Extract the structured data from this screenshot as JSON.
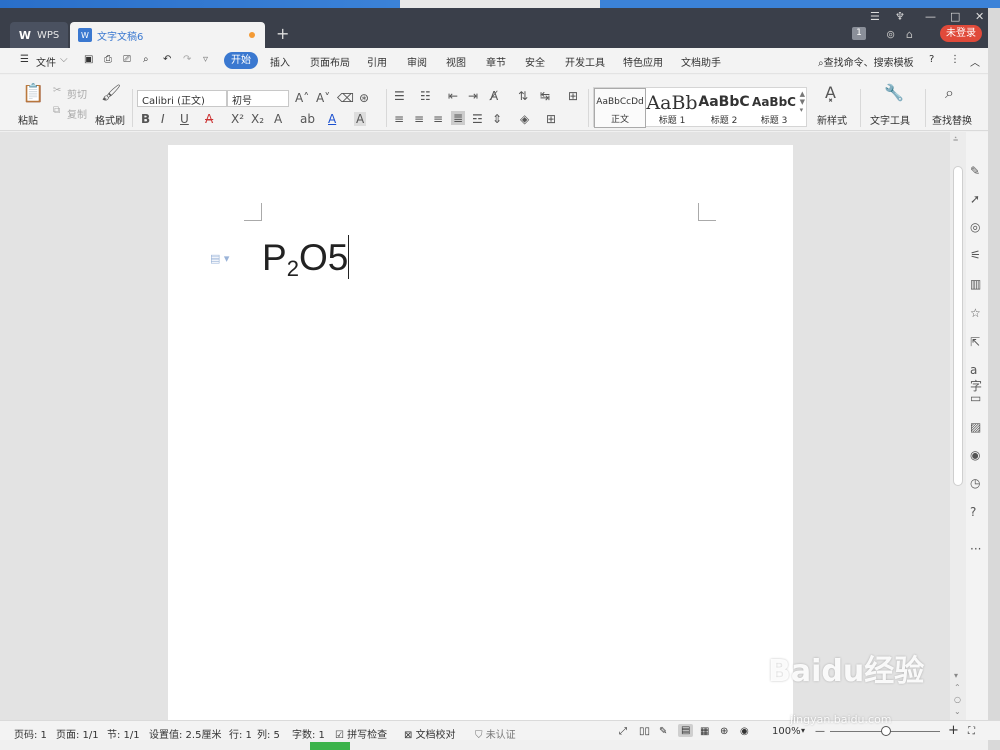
{
  "titlebar": {
    "tabs": [
      {
        "label": "WPS"
      },
      {
        "label": "文字文稿6"
      }
    ],
    "new_tab": "+",
    "badge": "1",
    "login": "未登录"
  },
  "menubar": {
    "file": "文件",
    "items": [
      "开始",
      "插入",
      "页面布局",
      "引用",
      "审阅",
      "视图",
      "章节",
      "安全",
      "开发工具",
      "特色应用",
      "文档助手"
    ],
    "search": "查找命令、搜索模板",
    "help": "?"
  },
  "ribbon": {
    "paste": "粘贴",
    "cut": "剪切",
    "copy": "复制",
    "format_painter": "格式刷",
    "font_name": "Calibri (正文)",
    "font_size": "初号",
    "styles": [
      {
        "sample": "AaBbCcDd",
        "name": "正文"
      },
      {
        "sample": "AaBb",
        "name": "标题 1"
      },
      {
        "sample": "AaBbC",
        "name": "标题 2"
      },
      {
        "sample": "AaBbC",
        "name": "标题 3"
      }
    ],
    "new_style": "新样式",
    "text_tools": "文字工具",
    "find_replace": "查找替换"
  },
  "document": {
    "text_p": "P",
    "text_sub": "2",
    "text_rest": "O5"
  },
  "statusbar": {
    "page_num": "页码: 1",
    "page": "页面: 1/1",
    "section": "节: 1/1",
    "setting": "设置值: 2.5厘米",
    "row": "行: 1",
    "col": "列: 5",
    "words": "字数: 1",
    "spell": "拼写检查",
    "proof": "文档校对",
    "cert": "未认证",
    "zoom": "100%"
  },
  "watermark": {
    "main": "Baidu经验",
    "sub": "jingyan.baidu.com"
  },
  "colors": {
    "accent": "#3a78d0",
    "login": "#e04a3a",
    "titlebar": "#3a3f4a"
  }
}
